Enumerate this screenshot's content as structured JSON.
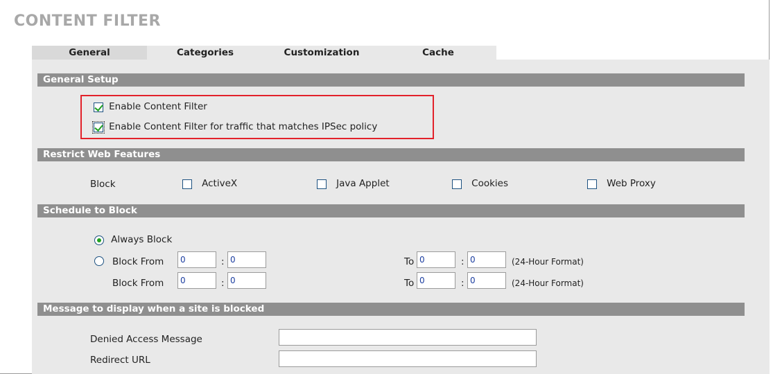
{
  "page": {
    "title": "CONTENT FILTER"
  },
  "tabs": [
    {
      "label": "General",
      "active": true
    },
    {
      "label": "Categories",
      "active": false
    },
    {
      "label": "Customization",
      "active": false
    },
    {
      "label": "Cache",
      "active": false
    }
  ],
  "general_setup": {
    "heading": "General Setup",
    "enable_content_filter": {
      "label": "Enable Content Filter",
      "checked": true
    },
    "enable_ipsec": {
      "label": "Enable Content Filter for traffic that matches IPSec policy",
      "checked": true
    }
  },
  "restrict": {
    "heading": "Restrict Web Features",
    "block_label": "Block",
    "options": [
      {
        "label": "ActiveX",
        "checked": false
      },
      {
        "label": "Java Applet",
        "checked": false
      },
      {
        "label": "Cookies",
        "checked": false
      },
      {
        "label": "Web Proxy",
        "checked": false
      }
    ]
  },
  "schedule": {
    "heading": "Schedule to Block",
    "always_block": {
      "label": "Always Block",
      "selected": true
    },
    "block_from_radio": {
      "label": "Block From",
      "selected": false
    },
    "rows": [
      {
        "from_label": "Block From",
        "from_h": "0",
        "from_m": "0",
        "to_label": "To",
        "to_h": "0",
        "to_m": "0",
        "format": "(24-Hour Format)"
      },
      {
        "from_label": "Block From",
        "from_h": "0",
        "from_m": "0",
        "to_label": "To",
        "to_h": "0",
        "to_m": "0",
        "format": "(24-Hour Format)"
      }
    ],
    "colon": ":"
  },
  "message": {
    "heading": "Message to display when a site is blocked",
    "denied_label": "Denied Access Message",
    "denied_value": "",
    "redirect_label": "Redirect URL",
    "redirect_value": ""
  },
  "colors": {
    "section_bar": "#8f8f8f",
    "highlight_border": "#e2212a",
    "check_mark": "#21a121",
    "title": "#a8a8a8"
  }
}
